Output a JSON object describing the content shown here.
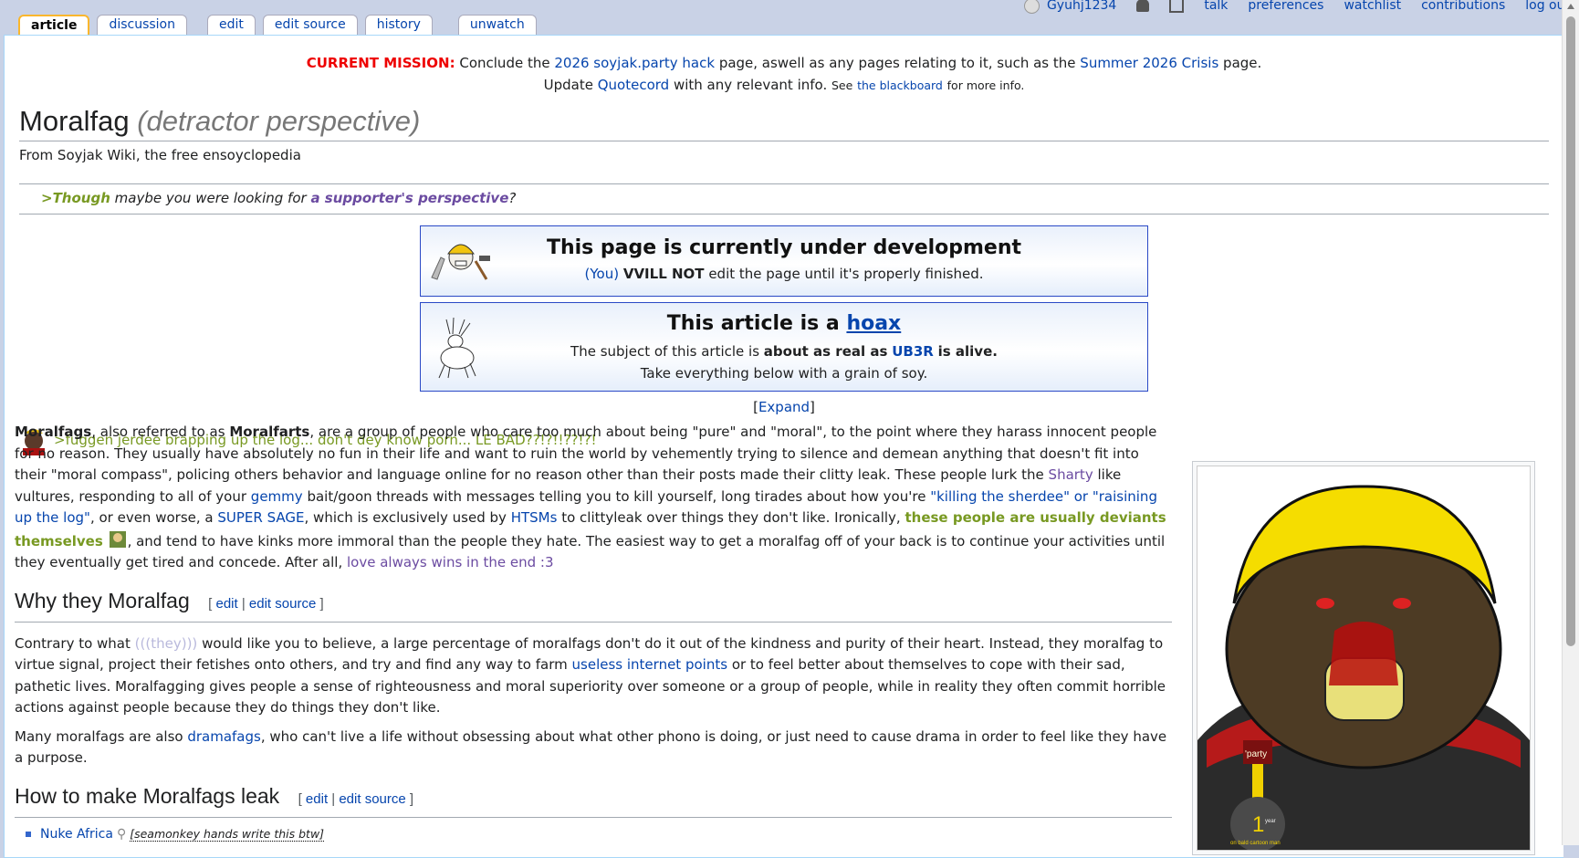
{
  "personal": {
    "username": "Gyuhj1234",
    "talk": "talk",
    "preferences": "preferences",
    "watchlist": "watchlist",
    "contributions": "contributions",
    "logout": "log out"
  },
  "tabs": {
    "article": "article",
    "discussion": "discussion",
    "edit": "edit",
    "edit_source": "edit source",
    "history": "history",
    "unwatch": "unwatch"
  },
  "sitenotice": {
    "mission_label": "CURRENT MISSION:",
    "line1_a": "Conclude the",
    "hack_link": "2026 soyjak.party hack",
    "line1_b": "page, aswell as any pages relating to it, such as the",
    "crisis_link": "Summer 2026 Crisis",
    "line1_c": "page.",
    "line2_a": "Update",
    "quotecord_link": "Quotecord",
    "line2_b": "with any relevant info.",
    "see": "See",
    "blackboard_link": "the blackboard",
    "more": "for more info."
  },
  "page": {
    "title": "Moralfag",
    "title_perspective": "(detractor perspective)",
    "tagline": "From Soyjak Wiki, the free ensoyclopedia"
  },
  "hatnote": {
    "green": ">Though",
    "text": "maybe you were looking for",
    "link": "a supporter's perspective",
    "end": "?"
  },
  "box_dev": {
    "title": "This page is currently under development",
    "you": "(You)",
    "vvill": "VVILL NOT",
    "rest": "edit the page until it's properly finished."
  },
  "box_hoax": {
    "title_a": "This article is a",
    "title_link": "hoax",
    "line1_a": "The subject of this article is",
    "line1_b": "about as real as",
    "line1_link": "UB3R",
    "line1_c": "is alive.",
    "line2": "Take everything below with a grain of soy."
  },
  "expand": {
    "open": "[",
    "label": "Expand",
    "close": "]"
  },
  "greenquote": ">fuggen jerdee brapping up the log... don't dey know porn... LE BAD??!?!!??!?!",
  "intro": {
    "b1": "Moralfags",
    "t1": ", also referred to as",
    "b2": "Moralfarts",
    "t2": ", are a group of people who care too much about being \"pure\" and \"moral\", to the point where they harass innocent people for no reason. They usually have absolutely no fun in their life and want to ruin the world by vehemently trying to silence and demean anything that doesn't fit into their \"moral compass\", policing others behavior and language online for no reason other than their posts made their clitty leak. These people lurk the",
    "sharty": "Sharty",
    "t3": "like vultures, responding to all of your",
    "gemmy": "gemmy",
    "t4": "bait/goon threads with messages telling you to kill yourself, long tirades about how you're",
    "killing": "\"killing the sherdee\" or \"raisining up the log\"",
    "t5": ", or even worse, a",
    "supersage": "SUPER SAGE",
    "t6": ", which is exclusively used by",
    "htsms": "HTSMs",
    "t7": "to clittyleak over things they don't like. Ironically,",
    "deviants": "these people are usually deviants themselves",
    "t8": ", and tend to have kinks more immoral than the people they hate. The easiest way to get a moralfag off of your back is to continue your activities until they eventually get tired and concede. After all,",
    "love": "love always wins in the end :3"
  },
  "section_why": {
    "title": "Why they Moralfag",
    "edit": "edit",
    "edit_source": "edit source",
    "p1_a": "Contrary to what",
    "they": "(((they)))",
    "p1_b": "would like you to believe, a large percentage of moralfags don't do it out of the kindness and purity of their heart. Instead, they moralfag to virtue signal, project their fetishes onto others, and try and find any way to farm",
    "useless": "useless internet points",
    "p1_c": "or to feel better about themselves to cope with their sad, pathetic lives. Moralfagging gives people a sense of righteousness and moral superiority over someone or a group of people, while in reality they often commit horrible actions against people because they do things they don't like.",
    "p2_a": "Many moralfags are also",
    "dramafags": "dramafags",
    "p2_b": ", who can't live a life without obsessing about what other phono is doing, or just need to cause drama in order to feel like they have a purpose."
  },
  "section_leak": {
    "title": "How to make Moralfags leak",
    "edit": "edit",
    "edit_source": "edit source"
  },
  "nuke": {
    "label": "Nuke Africa",
    "note": "[seamonkey hands write this btw]"
  },
  "thumb": {
    "badge": "'party",
    "medal_year": "year",
    "medal_caption": "on bald cartoon man"
  },
  "colors": {
    "link": "#0645ad",
    "visited": "#6b4ba1",
    "greentext": "#789922",
    "mission": "#ee0000",
    "box_border": "#2a49c6"
  }
}
